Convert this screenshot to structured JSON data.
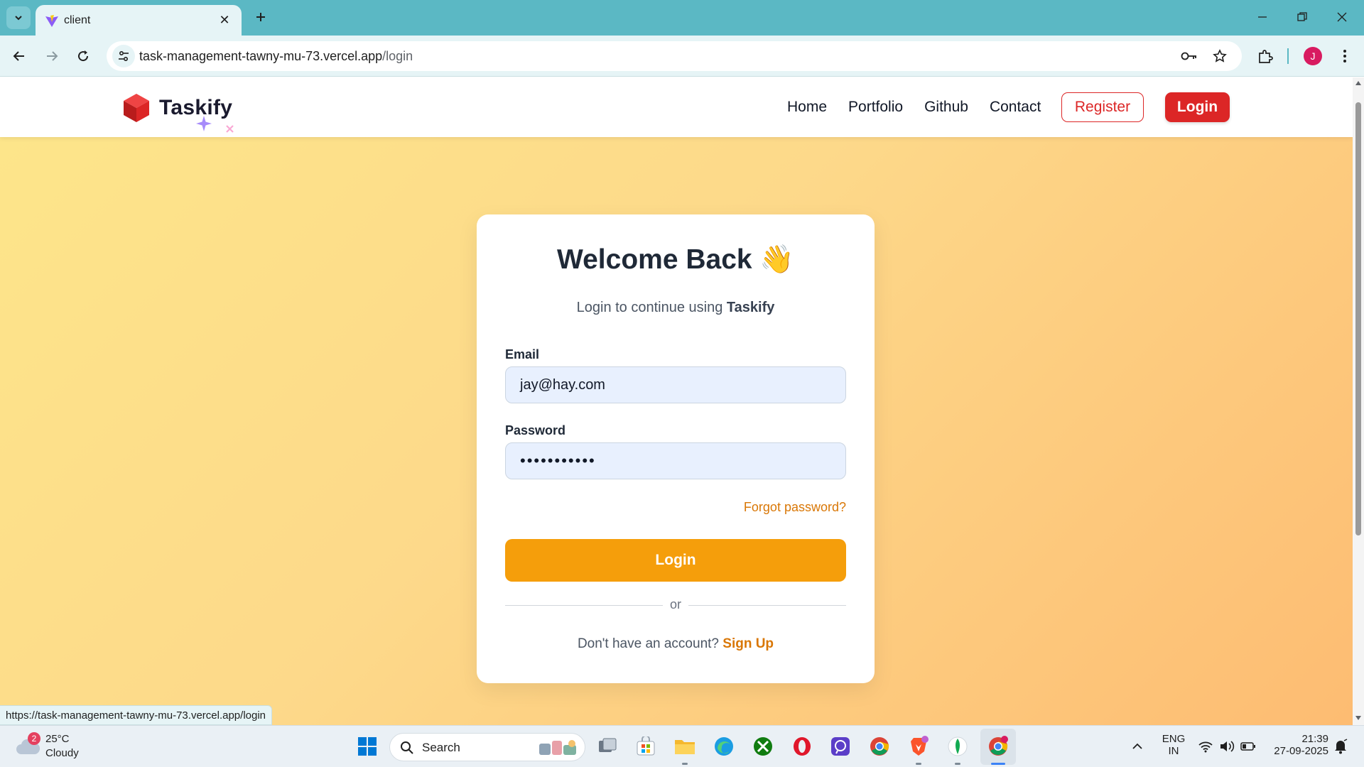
{
  "browser": {
    "tab_title": "client",
    "url_host": "task-management-tawny-mu-73.vercel.app",
    "url_path": "/login",
    "profile_initial": "J",
    "status_url": "https://task-management-tawny-mu-73.vercel.app/login"
  },
  "navbar": {
    "brand": "Taskify",
    "links": [
      "Home",
      "Portfolio",
      "Github",
      "Contact"
    ],
    "register_label": "Register",
    "login_label": "Login"
  },
  "login_card": {
    "title": "Welcome Back 👋",
    "subtitle_prefix": "Login to continue using ",
    "subtitle_brand": "Taskify",
    "email_label": "Email",
    "email_value": "jay@hay.com",
    "password_label": "Password",
    "password_value": "•••••••••••",
    "forgot_label": "Forgot password?",
    "login_button": "Login",
    "divider_text": "or",
    "signup_prompt": "Don't have an account? ",
    "signup_link": "Sign Up"
  },
  "colors": {
    "accent": "#f59e0b",
    "brand_red": "#dc2626",
    "link_orange": "#d97706"
  },
  "taskbar": {
    "weather_badge": "2",
    "weather_temp": "25°C",
    "weather_cond": "Cloudy",
    "search_label": "Search",
    "lang_primary": "ENG",
    "lang_region": "IN",
    "time": "21:39",
    "date": "27-09-2025"
  }
}
